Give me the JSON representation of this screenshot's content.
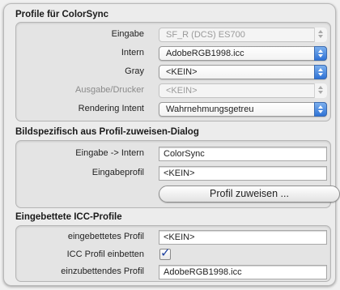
{
  "section1": {
    "title": "Profile für ColorSync",
    "rows": [
      {
        "label": "Eingabe",
        "value": "SF_R (DCS) ES700",
        "disabled": true
      },
      {
        "label": "Intern",
        "value": "AdobeRGB1998.icc",
        "disabled": false
      },
      {
        "label": "Gray",
        "value": "<KEIN>",
        "disabled": false
      },
      {
        "label": "Ausgabe/Drucker",
        "value": "<KEIN>",
        "disabled": true
      },
      {
        "label": "Rendering Intent",
        "value": "Wahrnehmungsgetreu",
        "disabled": false
      }
    ]
  },
  "section2": {
    "title": "Bildspezifisch aus Profil-zuweisen-Dialog",
    "rows": [
      {
        "label": "Eingabe -> Intern",
        "value": "ColorSync"
      },
      {
        "label": "Eingabeprofil",
        "value": "<KEIN>"
      }
    ],
    "button_label": "Profil zuweisen ..."
  },
  "section3": {
    "title": "Eingebettete ICC-Profile",
    "embedded_label": "eingebettetes Profil",
    "embedded_value": "<KEIN>",
    "embed_check_label": "ICC Profil einbetten",
    "embed_checked": true,
    "to_embed_label": "einzubettendes Profil",
    "to_embed_value": "AdobeRGB1998.icc"
  },
  "colors": {
    "accent": "#2f72d6",
    "check_mark": "#1b3f9e"
  },
  "icons": {
    "popup_arrow": "up-down-arrows-icon",
    "check": "checkmark-icon"
  }
}
